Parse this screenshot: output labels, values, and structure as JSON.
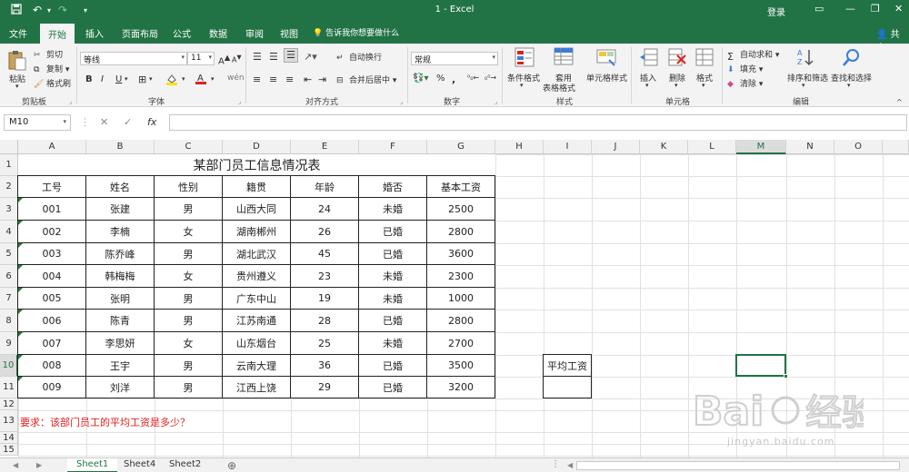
{
  "titlebar": {
    "title": "1  -  Excel",
    "login": "登录",
    "bg_color": "#217346"
  },
  "tabs": [
    {
      "label": "文件"
    },
    {
      "label": "开始",
      "active": true
    },
    {
      "label": "插入"
    },
    {
      "label": "页面布局"
    },
    {
      "label": "公式"
    },
    {
      "label": "数据"
    },
    {
      "label": "审阅"
    },
    {
      "label": "视图"
    }
  ],
  "tell_me": "告诉我你想要做什么",
  "share": "共享",
  "ribbon": {
    "clipboard": {
      "paste": "粘贴",
      "cut": "剪切",
      "copy": "复制",
      "format_painter": "格式刷",
      "label": "剪贴板"
    },
    "font": {
      "name": "等线",
      "size": "11",
      "bold": "B",
      "italic": "I",
      "underline": "U",
      "label": "字体"
    },
    "alignment": {
      "wrap": "自动换行",
      "merge": "合并后居中",
      "label": "对齐方式"
    },
    "number": {
      "format": "常规",
      "label": "数字"
    },
    "styles": {
      "conditional": "条件格式",
      "table_format_1": "套用",
      "table_format_2": "表格格式",
      "cell_styles": "单元格样式",
      "label": "样式"
    },
    "cells": {
      "insert": "插入",
      "delete": "删除",
      "format": "格式",
      "label": "单元格"
    },
    "editing": {
      "autosum": "自动求和",
      "fill": "填充",
      "clear": "清除",
      "sort": "排序和筛选",
      "find": "查找和选择",
      "label": "编辑"
    }
  },
  "formula_bar": {
    "name_box": "M10",
    "fx": "fx",
    "cancel": "✕",
    "enter": "✓"
  },
  "columns": [
    "A",
    "B",
    "C",
    "D",
    "E",
    "F",
    "G",
    "H",
    "I",
    "J",
    "K",
    "L",
    "M",
    "N",
    "O"
  ],
  "rows": [
    "1",
    "2",
    "3",
    "4",
    "5",
    "6",
    "7",
    "8",
    "9",
    "10",
    "11",
    "12",
    "13",
    "14",
    "15"
  ],
  "selected": {
    "col": "M",
    "row": "10"
  },
  "sheet": {
    "title": "某部门员工信息情况表",
    "headers": [
      "工号",
      "姓名",
      "性别",
      "籍贯",
      "年龄",
      "婚否",
      "基本工资"
    ],
    "data": [
      [
        "001",
        "张建",
        "男",
        "山西大同",
        "24",
        "未婚",
        "2500"
      ],
      [
        "002",
        "李楠",
        "女",
        "湖南郴州",
        "26",
        "已婚",
        "2800"
      ],
      [
        "003",
        "陈乔峰",
        "男",
        "湖北武汉",
        "45",
        "已婚",
        "3600"
      ],
      [
        "004",
        "韩梅梅",
        "女",
        "贵州遵义",
        "23",
        "未婚",
        "2300"
      ],
      [
        "005",
        "张明",
        "男",
        "广东中山",
        "19",
        "未婚",
        "1000"
      ],
      [
        "006",
        "陈青",
        "男",
        "江苏南通",
        "28",
        "已婚",
        "2800"
      ],
      [
        "007",
        "李思妍",
        "女",
        "山东烟台",
        "25",
        "未婚",
        "2700"
      ],
      [
        "008",
        "王宇",
        "男",
        "云南大理",
        "36",
        "已婚",
        "3500"
      ],
      [
        "009",
        "刘洋",
        "男",
        "江西上饶",
        "29",
        "已婚",
        "3200"
      ]
    ],
    "avg_label": "平均工资",
    "requirement": "要求：该部门员工的平均工资是多少？",
    "requirement_color": "#e0201d"
  },
  "sheet_tabs": [
    {
      "label": "Sheet1",
      "active": true
    },
    {
      "label": "Sheet4"
    },
    {
      "label": "Sheet2"
    }
  ],
  "add_sheet": "⊕",
  "watermark": "jingyan.baidu.com"
}
